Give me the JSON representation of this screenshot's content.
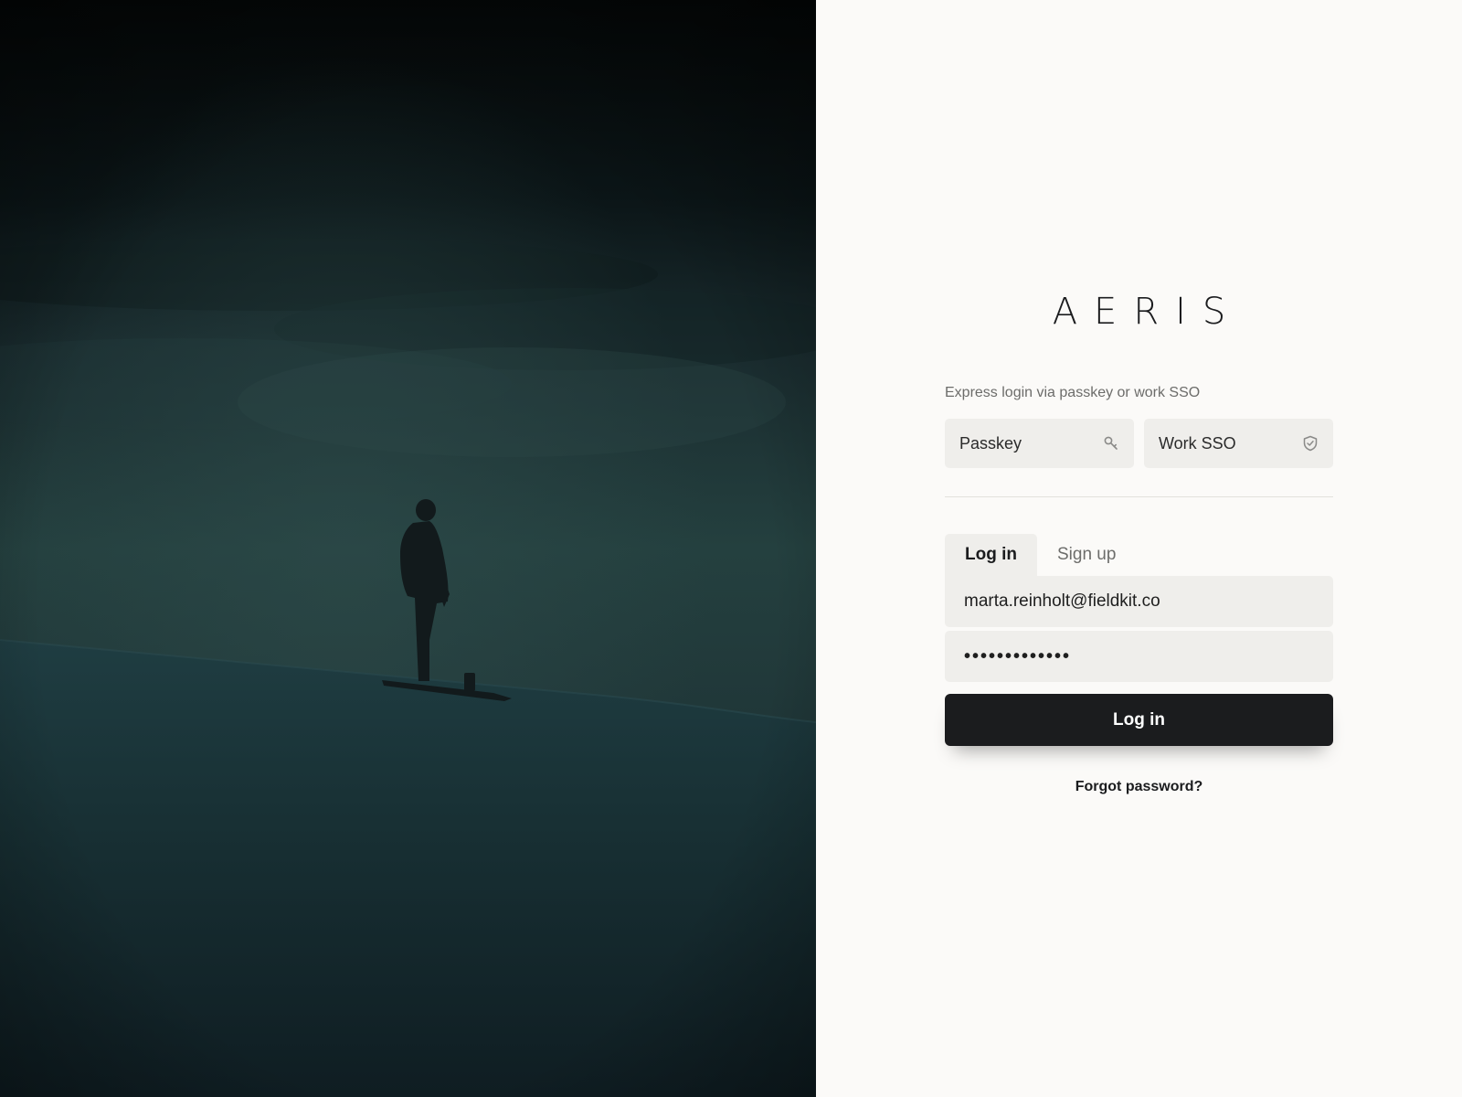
{
  "brand": {
    "name": "AERIS"
  },
  "express": {
    "label": "Express login via passkey or work SSO",
    "passkey": {
      "label": "Passkey",
      "icon": "key-icon"
    },
    "sso": {
      "label": "Work SSO",
      "icon": "shield-check-icon"
    }
  },
  "tabs": [
    {
      "label": "Log in",
      "active": true
    },
    {
      "label": "Sign up",
      "active": false
    }
  ],
  "form": {
    "email_value": "marta.reinholt@fieldkit.co",
    "password_value": "•••••••••••••",
    "submit_label": "Log in",
    "forgot_label": "Forgot password?"
  },
  "colors": {
    "panel_bg": "#fbfaf8",
    "field_bg": "#efeeeb",
    "primary": "#1b1c1e",
    "muted_text": "#6c6c6a"
  }
}
